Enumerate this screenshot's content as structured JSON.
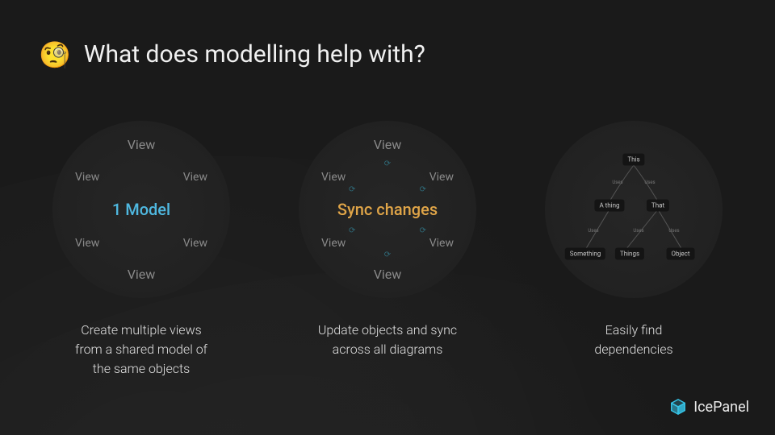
{
  "slide": {
    "emoji": "🧐",
    "title": "What does modelling help with?"
  },
  "panels": [
    {
      "center_label": "1 Model",
      "view_label": "View",
      "caption": "Create multiple views\nfrom a shared model of\nthe same objects"
    },
    {
      "center_label": "Sync changes",
      "view_label": "View",
      "caption": "Update objects and sync\nacross all diagrams"
    },
    {
      "caption": "Easily find\ndependencies",
      "tree": {
        "edge_label": "Uses",
        "nodes": {
          "root": "This",
          "l1a": "A thing",
          "l1b": "That",
          "l2a": "Something",
          "l2b": "Things",
          "l2c": "Object"
        }
      }
    }
  ],
  "brand": {
    "name": "IcePanel",
    "accent": "#36c3e6"
  }
}
